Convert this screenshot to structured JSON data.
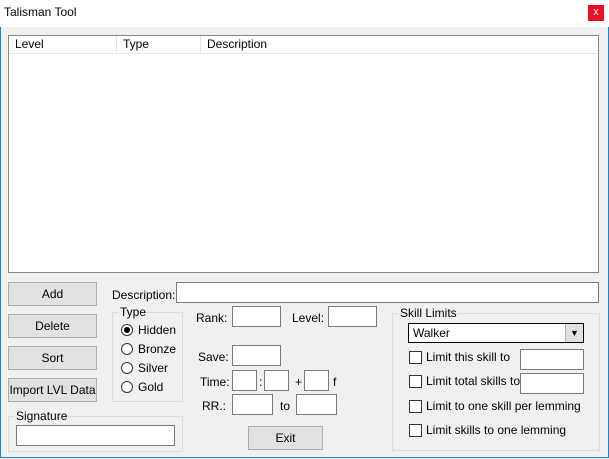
{
  "window": {
    "title": "Talisman Tool",
    "close_glyph": "x"
  },
  "list": {
    "columns": [
      "Level",
      "Type",
      "Description"
    ],
    "rows": []
  },
  "buttons": {
    "add": "Add",
    "delete": "Delete",
    "sort": "Sort",
    "import": "Import LVL Data",
    "exit": "Exit"
  },
  "description": {
    "label": "Description:",
    "value": ""
  },
  "type_group": {
    "title": "Type",
    "options": [
      {
        "label": "Hidden",
        "checked": true
      },
      {
        "label": "Bronze",
        "checked": false
      },
      {
        "label": "Silver",
        "checked": false
      },
      {
        "label": "Gold",
        "checked": false
      }
    ]
  },
  "fields": {
    "rank_label": "Rank:",
    "level_label": "Level:",
    "save_label": "Save:",
    "time_label": "Time:",
    "time_sep": ":",
    "time_plus": "+",
    "time_frames": "f",
    "rr_label": "RR.:",
    "rr_to": "to"
  },
  "skill_limits": {
    "title": "Skill Limits",
    "selected_skill": "Walker",
    "checks": [
      {
        "label": "Limit this skill to",
        "checked": false
      },
      {
        "label": "Limit total skills to",
        "checked": false
      },
      {
        "label": "Limit to one skill per lemming",
        "checked": false
      },
      {
        "label": "Limit skills to one lemming",
        "checked": false
      }
    ]
  },
  "signature": {
    "title": "Signature",
    "value": ""
  }
}
